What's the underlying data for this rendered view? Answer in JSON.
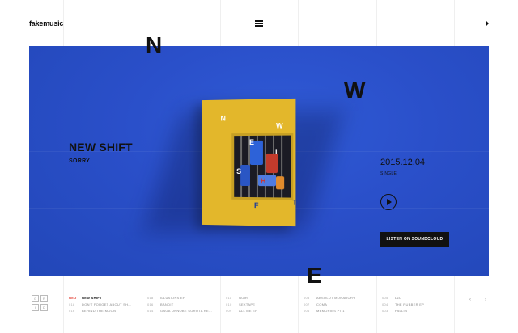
{
  "header": {
    "logo": "fakemusic"
  },
  "decor_letters": {
    "n": "N",
    "w": "W",
    "e": "E"
  },
  "hero": {
    "title": "NEW SHIFT",
    "subtitle": "SORRY",
    "release_date": "2015.12.04",
    "release_type": "SINGLE",
    "listen_label": "LISTEN ON SOUNDCLOUD",
    "background_color": "#2a4fc9"
  },
  "album": {
    "letters": [
      "N",
      "W",
      "E",
      "I",
      "S",
      "H",
      "F",
      "T"
    ],
    "cover_color": "#e3b72b"
  },
  "grid_icon_letters": [
    "G",
    "R",
    "I",
    "D"
  ],
  "tracks": {
    "columns": [
      [
        {
          "num": "NEO",
          "name": "NEW SHIFT",
          "active": true
        },
        {
          "num": "018",
          "name": "DON'T FORGET ABOUT SH..."
        },
        {
          "num": "016",
          "name": "BEHIND THE MOON"
        }
      ],
      [
        {
          "num": "018",
          "name": "ILLUSIONS EP"
        },
        {
          "num": "016",
          "name": "BANDIT"
        },
        {
          "num": "014",
          "name": "GAGA UNNOBE SOROTA RE..."
        }
      ],
      [
        {
          "num": "011",
          "name": "NOIR"
        },
        {
          "num": "010",
          "name": "SEXTAPE"
        },
        {
          "num": "009",
          "name": "ALL ME EP"
        }
      ],
      [
        {
          "num": "008",
          "name": "ABSOLUT MONARCHY"
        },
        {
          "num": "007",
          "name": "COMA"
        },
        {
          "num": "006",
          "name": "MEMORIES PT.1"
        }
      ],
      [
        {
          "num": "005",
          "name": "LZD"
        },
        {
          "num": "004",
          "name": "THE RUBBER EP"
        },
        {
          "num": "003",
          "name": "FALLIN"
        }
      ]
    ]
  },
  "pager": {
    "prev": "‹",
    "next": "›"
  }
}
